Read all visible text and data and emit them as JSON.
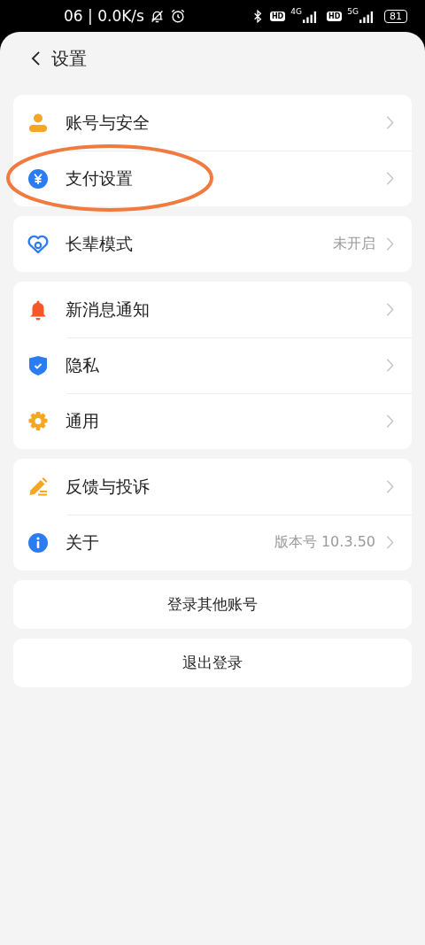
{
  "status_bar": {
    "time_speed": "06 | 0.0K/s",
    "network_1": {
      "hd": "HD",
      "type": "4G"
    },
    "network_2": {
      "hd": "HD",
      "type": "5G"
    },
    "battery": "81"
  },
  "header": {
    "title": "设置"
  },
  "groups": [
    {
      "rows": [
        {
          "label": "账号与安全"
        },
        {
          "label": "支付设置",
          "highlighted": true
        }
      ]
    },
    {
      "rows": [
        {
          "label": "长辈模式",
          "value": "未开启"
        }
      ]
    },
    {
      "rows": [
        {
          "label": "新消息通知"
        },
        {
          "label": "隐私"
        },
        {
          "label": "通用"
        }
      ]
    },
    {
      "rows": [
        {
          "label": "反馈与投诉"
        },
        {
          "label": "关于",
          "value": "版本号 10.3.50"
        }
      ]
    }
  ],
  "buttons": [
    "登录其他账号",
    "退出登录"
  ]
}
